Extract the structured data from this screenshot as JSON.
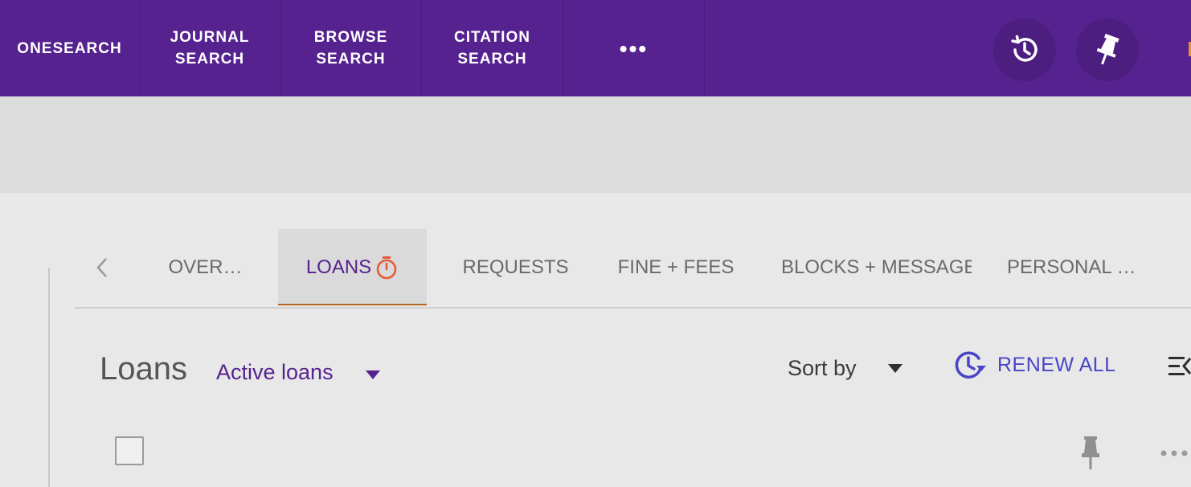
{
  "nav": {
    "items": [
      {
        "line1": "ONESEARCH",
        "line2": ""
      },
      {
        "line1": "JOURNAL",
        "line2": "SEARCH"
      },
      {
        "line1": "BROWSE",
        "line2": "SEARCH"
      },
      {
        "line1": "CITATION",
        "line2": "SEARCH"
      }
    ],
    "more_label": "•••",
    "history_icon": "history-icon",
    "pin_icon": "pin-icon",
    "accent_color": "#e7912d",
    "bar_color": "#56228f"
  },
  "tabs": {
    "prev_icon": "chevron-left-icon",
    "items": [
      {
        "label": "OVER…"
      },
      {
        "label": "LOANS",
        "icon": "timer-icon",
        "selected": true
      },
      {
        "label": "REQUESTS"
      },
      {
        "label": "FINE + FEES"
      },
      {
        "label": "BLOCKS + MESSAGES"
      },
      {
        "label": "PERSONAL …"
      }
    ],
    "active_underline_color": "#b5651d"
  },
  "loans": {
    "title": "Loans",
    "filter_value": "Active loans",
    "sort_label": "Sort by",
    "renew_all_label": "RENEW ALL",
    "renew_icon": "renew-clock-icon",
    "list_icon": "list-options-icon",
    "row_pin_icon": "pin-icon",
    "row_more_icon": "more-horizontal-icon"
  }
}
